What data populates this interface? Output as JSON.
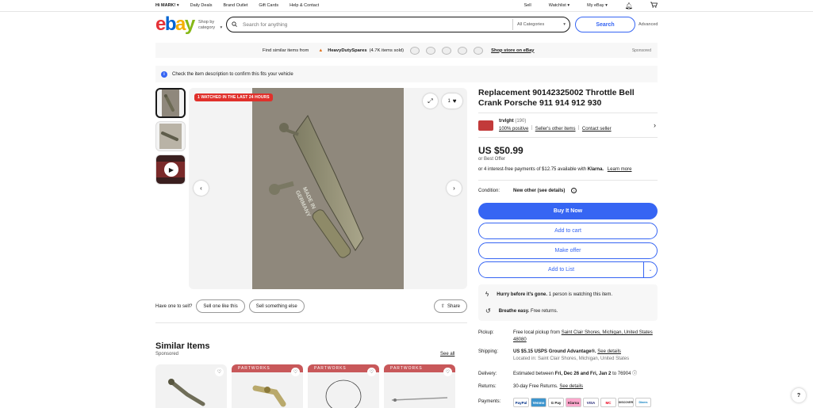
{
  "topnav": {
    "greeting": "Hi MARK!",
    "daily_deals": "Daily Deals",
    "brand_outlet": "Brand Outlet",
    "gift_cards": "Gift Cards",
    "help_contact": "Help & Contact",
    "sell": "Sell",
    "watchlist": "Watchlist",
    "my_ebay": "My eBay"
  },
  "header": {
    "logo": [
      "e",
      "b",
      "a",
      "y"
    ],
    "shop_by_category": "Shop by category",
    "search_placeholder": "Search for anything",
    "category": "All Categories",
    "search_button": "Search",
    "advanced": "Advanced"
  },
  "banner": {
    "find_similar": "Find similar items from",
    "seller": "HeavyDutySpares",
    "items_sold": "(4.7K items sold)",
    "shop_store": "Shop store on eBay",
    "sponsored": "Sponsored"
  },
  "notice": {
    "text": "Check the item description to confirm this fits your vehicle"
  },
  "gallery": {
    "watched_badge": "1 WATCHED IN THE LAST 24 HOURS",
    "watch_count": "1"
  },
  "sell_row": {
    "prompt": "Have one to sell?",
    "sell_one": "Sell one like this",
    "sell_something": "Sell something else",
    "share": "Share"
  },
  "similar": {
    "title": "Similar Items",
    "sponsored": "Sponsored",
    "see_all": "See all",
    "card_header": "PARTWORKS"
  },
  "listing": {
    "title": "Replacement 90142325002 Throttle Bell Crank Porsche 911 914 912 930",
    "seller_name": "trvlght",
    "seller_score": "(190)",
    "positive": "100% positive",
    "other_items": "Seller's other items",
    "contact": "Contact seller",
    "price": "US $50.99",
    "best_offer": "or Best Offer",
    "klarna_text": "or 4 interest-free payments of $12.75 available with",
    "klarna_brand": "Klarna.",
    "learn_more": "Learn more",
    "condition_label": "Condition:",
    "condition_value": "New other (see details)",
    "buy_now": "Buy It Now",
    "add_to_cart": "Add to cart",
    "make_offer": "Make offer",
    "add_to_list": "Add to List",
    "hurry_title": "Hurry before it's gone.",
    "hurry_text": "1 person is watching this item.",
    "breathe_title": "Breathe easy.",
    "breathe_text": "Free returns."
  },
  "shipping": {
    "pickup_label": "Pickup:",
    "pickup_text": "Free local pickup from",
    "pickup_location": "Saint Clair Shores, Michigan, United States 48080",
    "shipping_label": "Shipping:",
    "shipping_text": "US $5.15 USPS Ground Advantage®.",
    "see_details": "See details",
    "located": "Located in: Saint Clair Shores, Michigan, United States",
    "delivery_label": "Delivery:",
    "delivery_text": "Estimated between",
    "delivery_dates": "Fri, Dec 26 and Fri, Jan 2",
    "delivery_zip": "to 76904",
    "returns_label": "Returns:",
    "returns_text": "30-day Free Returns.",
    "returns_details": "See details",
    "payments_label": "Payments:",
    "payment_methods": [
      "PayPal",
      "Venmo",
      "G Pay",
      "Klarna",
      "VISA",
      "MC",
      "DISCOVER",
      "Diners"
    ]
  },
  "help": "?"
}
